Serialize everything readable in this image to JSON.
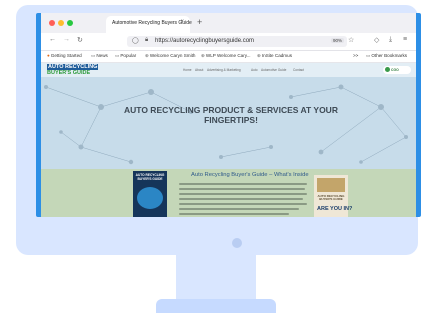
{
  "browser": {
    "tab_title": "Automotive Recycling Buyers Guide",
    "tab_close": "×",
    "new_tab": "+",
    "url": "https://autorecyclingbuyersguide.com",
    "zoom": "90%",
    "bookmarks": [
      {
        "label": "Getting Started",
        "icon": "firefox-icon"
      },
      {
        "label": "News",
        "icon": "folder-icon"
      },
      {
        "label": "Popular",
        "icon": "folder-icon"
      },
      {
        "label": "Welcome Caryn Smith",
        "icon": "globe-icon"
      },
      {
        "label": "WLP Welcome Cary...",
        "icon": "globe-icon"
      },
      {
        "label": "InSite Cadmus",
        "icon": "globe-icon"
      }
    ],
    "other_bookmarks": "Other Bookmarks",
    "bookmark_overflow": ">>"
  },
  "page": {
    "logo_line1": "AUTO RECYCLING",
    "logo_line2": "BUYER'S GUIDE",
    "nav": [
      "Home",
      "About",
      "Advertising & Marketing",
      "Auto",
      "Automotive Guide",
      "Contact"
    ],
    "badge": "CGO",
    "hero_title_line1": "AUTO RECYCLING PRODUCT & SERVICES AT YOUR",
    "hero_title_line2": "FINGERTIPS!",
    "section_heading": "Auto Recycling Buyer's Guide – What's Inside",
    "book_title": "AUTO RECYCLING BUYER'S GUIDE",
    "card_subtitle": "AUTO RECYCLING BUYER'S GUIDE",
    "card_cta": "ARE YOU IN?"
  },
  "colors": {
    "monitor": "#d9e6ff",
    "screen_bezel": "#2d8fe6",
    "hero_text": "#3e4a55",
    "section_bg": "#c4d7b8",
    "heading_blue": "#2f5a8a"
  }
}
